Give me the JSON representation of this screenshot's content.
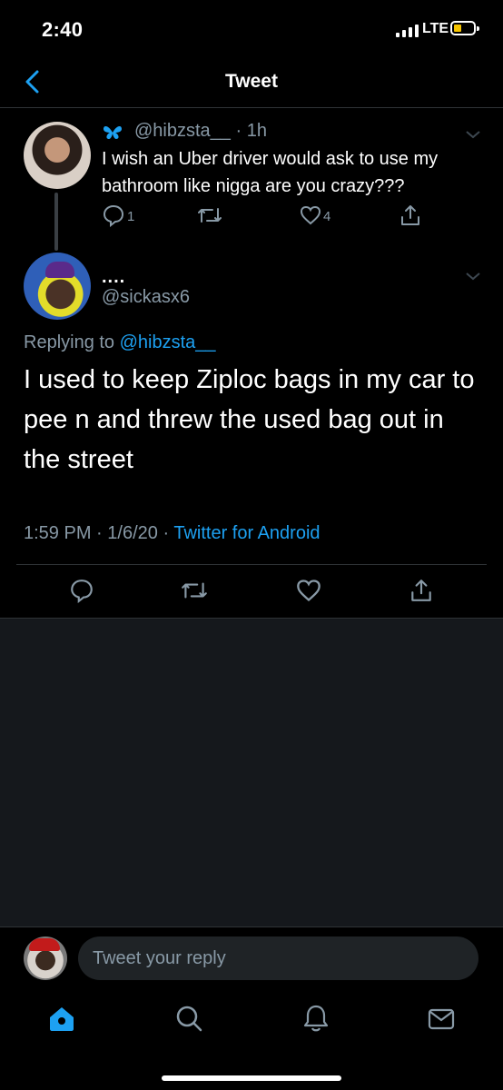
{
  "status_bar": {
    "time": "2:40",
    "network": "LTE",
    "battery_color": "#f5c400"
  },
  "header": {
    "title": "Tweet"
  },
  "original_tweet": {
    "handle": "@hibzsta__",
    "time_sep": "·",
    "age": "1h",
    "text": "I wish an Uber driver would ask to use my bathroom like nigga are you crazy???",
    "reply_count": "1",
    "like_count": "4",
    "name_icon": "butterfly-icon"
  },
  "main_tweet": {
    "display_name": "....",
    "handle": "@sickasx6",
    "replying_prefix": "Replying to",
    "replying_to": "@hibzsta__",
    "text": "I used to keep Ziploc bags in my car to pee n and threw the used bag out in the street",
    "time": "1:59 PM",
    "sep1": "·",
    "date": "1/6/20",
    "sep2": "·",
    "source": "Twitter for Android"
  },
  "reply_bar": {
    "placeholder": "Tweet your reply"
  },
  "tab_bar": {
    "items": [
      "home-icon",
      "search-icon",
      "notifications-icon",
      "messages-icon"
    ]
  },
  "colors": {
    "accent": "#1da1f2",
    "muted": "#8899a6",
    "background": "#000000",
    "empty_area": "#15181c"
  }
}
